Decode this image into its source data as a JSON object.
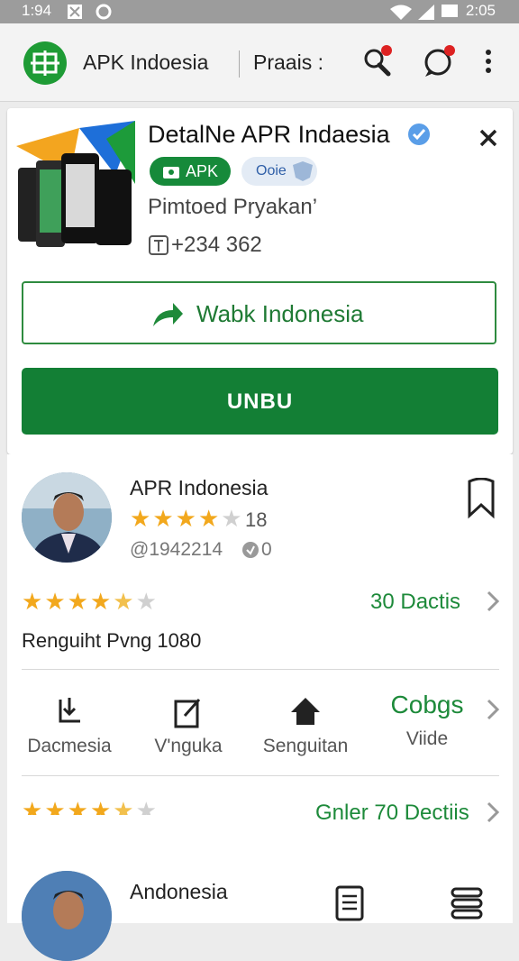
{
  "status": {
    "time": "1:94",
    "battery_time": "2:05"
  },
  "appbar": {
    "title": "APK Indoesia",
    "secondary": "Praais :"
  },
  "detail": {
    "title": "DetalNe APR Indaesia",
    "chip_apk": "APK",
    "chip_secondary": "Ooie",
    "publisher": "Pimtoed Pryakan’",
    "phone": "+234 362",
    "outline_button": "Wabk Indonesia",
    "primary_button": "UNBU"
  },
  "developer": {
    "name": "APR Indonesia",
    "rating_count": "18",
    "id_text": "@1942214",
    "id_badge": "0",
    "rating_value": 4.5,
    "review_link": "30 Dactis",
    "requirement": "Renguiht Pvng 1080"
  },
  "actions": [
    {
      "label": "Dacmesia",
      "icon": "install-icon"
    },
    {
      "label": "V'nguka",
      "icon": "edit-icon"
    },
    {
      "label": "Senguitan",
      "icon": "home-icon"
    }
  ],
  "actions_extra": {
    "big": "Cobgs",
    "small": "Viide"
  },
  "section2": {
    "rating_value": 4.5,
    "review_link": "Gnler 70 Dectiis",
    "dev_name": "Andonesia"
  },
  "colors": {
    "brand_green": "#137f35",
    "star": "#f2a81d",
    "status_bar": "#9c9c9c"
  }
}
